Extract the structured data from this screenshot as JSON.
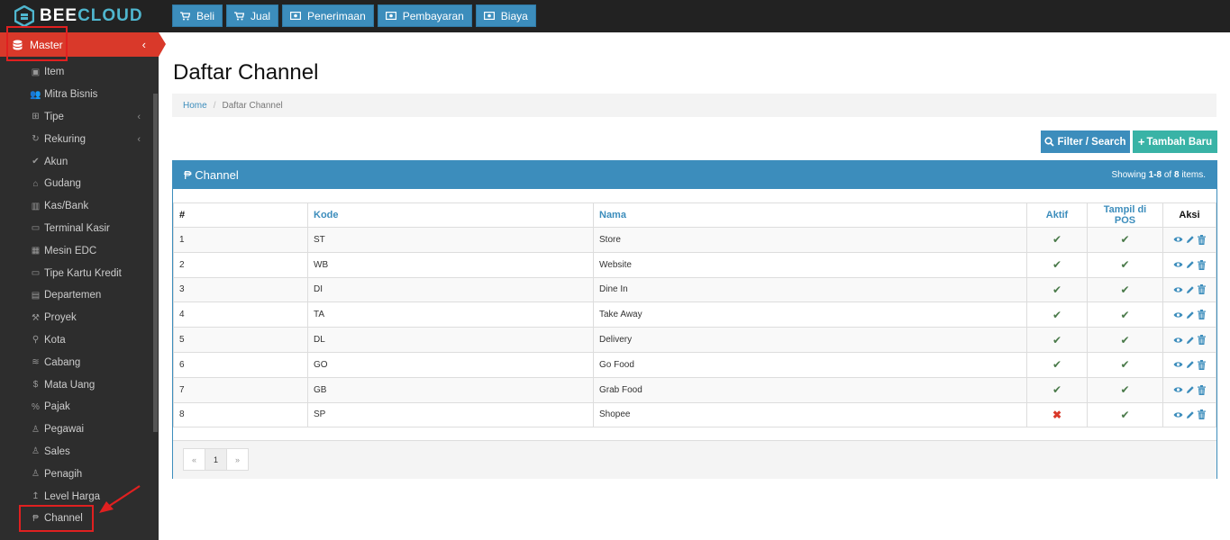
{
  "brand": {
    "part1": "BEE",
    "part2": "CLOUD"
  },
  "topnav": [
    {
      "label": "Beli",
      "icon": "cart-icon"
    },
    {
      "label": "Jual",
      "icon": "cart-icon"
    },
    {
      "label": "Penerimaan",
      "icon": "money-icon"
    },
    {
      "label": "Pembayaran",
      "icon": "money-icon"
    },
    {
      "label": "Biaya",
      "icon": "money-icon"
    }
  ],
  "user": {
    "name": "",
    "email": ""
  },
  "sidebar": {
    "master_label": "Master",
    "items": [
      {
        "label": "Item"
      },
      {
        "label": "Mitra Bisnis"
      },
      {
        "label": "Tipe"
      },
      {
        "label": "Rekuring"
      },
      {
        "label": "Akun"
      },
      {
        "label": "Gudang"
      },
      {
        "label": "Kas/Bank"
      },
      {
        "label": "Terminal Kasir"
      },
      {
        "label": "Mesin EDC"
      },
      {
        "label": "Tipe Kartu Kredit"
      },
      {
        "label": "Departemen"
      },
      {
        "label": "Proyek"
      },
      {
        "label": "Kota"
      },
      {
        "label": "Cabang"
      },
      {
        "label": "Mata Uang"
      },
      {
        "label": "Pajak"
      },
      {
        "label": "Pegawai"
      },
      {
        "label": "Sales"
      },
      {
        "label": "Penagih"
      },
      {
        "label": "Level Harga"
      },
      {
        "label": "Channel"
      }
    ]
  },
  "page": {
    "title": "Daftar Channel",
    "breadcrumb": {
      "home": "Home",
      "current": "Daftar Channel"
    },
    "filter_label": "Filter / Search",
    "add_label": "Tambah Baru"
  },
  "panel": {
    "title": "Channel",
    "showing_prefix": "Showing ",
    "showing_range": "1-8",
    "showing_of": " of ",
    "showing_total": "8",
    "showing_suffix": " items."
  },
  "table": {
    "headers": {
      "num": "#",
      "kode": "Kode",
      "nama": "Nama",
      "aktif": "Aktif",
      "pos": "Tampil di POS",
      "aksi": "Aksi"
    },
    "rows": [
      {
        "num": "1",
        "kode": "ST",
        "nama": "Store",
        "aktif": true,
        "pos": true
      },
      {
        "num": "2",
        "kode": "WB",
        "nama": "Website",
        "aktif": true,
        "pos": true
      },
      {
        "num": "3",
        "kode": "DI",
        "nama": "Dine In",
        "aktif": true,
        "pos": true
      },
      {
        "num": "4",
        "kode": "TA",
        "nama": "Take Away",
        "aktif": true,
        "pos": true
      },
      {
        "num": "5",
        "kode": "DL",
        "nama": "Delivery",
        "aktif": true,
        "pos": true
      },
      {
        "num": "6",
        "kode": "GO",
        "nama": "Go Food",
        "aktif": true,
        "pos": true
      },
      {
        "num": "7",
        "kode": "GB",
        "nama": "Grab Food",
        "aktif": true,
        "pos": true
      },
      {
        "num": "8",
        "kode": "SP",
        "nama": "Shopee",
        "aktif": false,
        "pos": true
      }
    ]
  },
  "pagination": {
    "prev": "«",
    "current": "1",
    "next": "»"
  },
  "colors": {
    "primary": "#3c8dbc",
    "danger": "#d9392a",
    "teal": "#39b3a6",
    "sidebar": "#2d2d2d"
  }
}
